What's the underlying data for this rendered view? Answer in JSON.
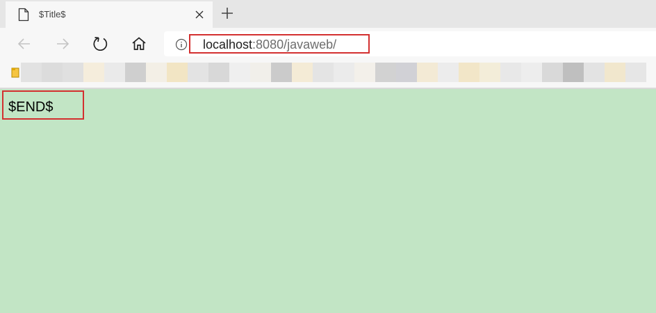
{
  "tab": {
    "title": "$Title$",
    "page_icon": "page-icon",
    "close_icon": "close-icon"
  },
  "new_tab_icon": "plus-icon",
  "toolbar": {
    "back_icon": "back-arrow-icon",
    "forward_icon": "forward-arrow-icon",
    "refresh_icon": "refresh-icon",
    "home_icon": "home-icon",
    "info_icon": "info-icon"
  },
  "address": {
    "host": "localhost",
    "rest": ":8080/javaweb/"
  },
  "bookmarks": {
    "folder_icon": "folder-icon",
    "blurred_colors": [
      "#e2e2e2",
      "#dcdcdc",
      "#e0e0e0",
      "#f5eddc",
      "#eaeaea",
      "#cfcfcf",
      "#f3efe6",
      "#f2e5c4",
      "#e3e3e3",
      "#d8d8d8",
      "#efefef",
      "#f1efea",
      "#cbcbcb",
      "#f4ebd6",
      "#e4e4e4",
      "#ebebeb",
      "#f3f0ea",
      "#d2d2d2",
      "#d1d1d6",
      "#f3ead5",
      "#ececec",
      "#f2e6c8",
      "#f3edd9",
      "#e8e8e8",
      "#ededed",
      "#d9d9d9",
      "#bfbfbf",
      "#e3e3e3",
      "#f1e7cd",
      "#e6e6e6"
    ]
  },
  "content": {
    "text": "$END$"
  },
  "colors": {
    "page_background": "#c2e5c5",
    "highlight_border": "#d32f2f"
  }
}
